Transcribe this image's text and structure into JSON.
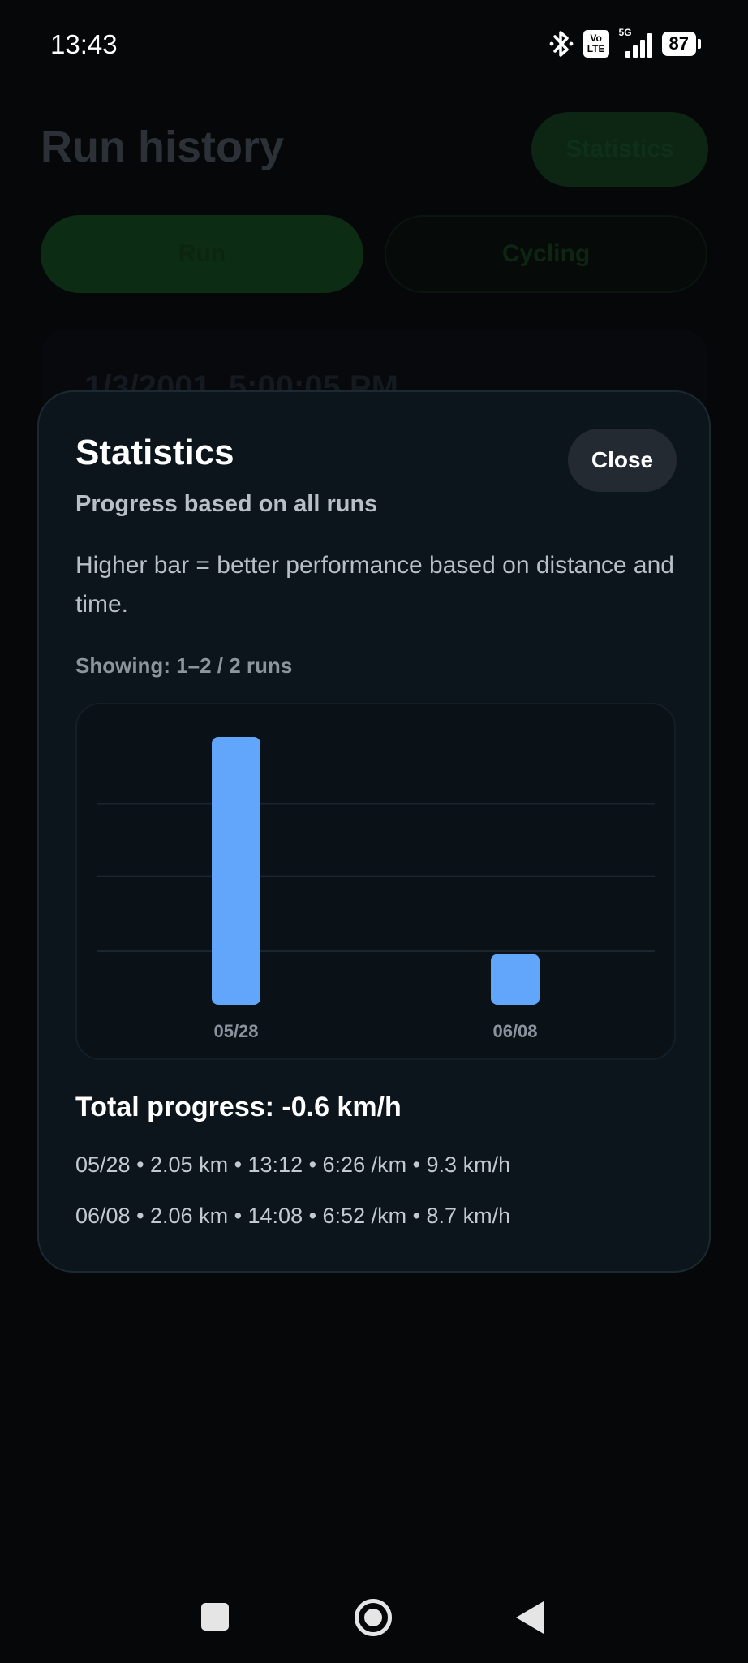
{
  "status_bar": {
    "time": "13:43",
    "volte_top": "Vo",
    "volte_bottom": "LTE",
    "network": "5G",
    "battery": "87"
  },
  "background": {
    "title": "Run history",
    "statistics_button": "Statistics",
    "tabs": [
      {
        "label": "Run",
        "selected": true
      },
      {
        "label": "Cycling",
        "selected": false
      }
    ],
    "card_date": "1/3/2001, 5:00:05 PM"
  },
  "modal": {
    "title": "Statistics",
    "close_label": "Close",
    "subtitle": "Progress based on all runs",
    "description": "Higher bar = better performance based on distance and time.",
    "showing": "Showing: 1–2 / 2 runs",
    "total_progress": "Total progress: -0.6 km/h",
    "runs": [
      {
        "summary": "05/28 • 2.05 km • 13:12 • 6:26 /km • 9.3 km/h"
      },
      {
        "summary": "06/08 • 2.06 km • 14:08 • 6:52 /km • 8.7 km/h"
      }
    ]
  },
  "chart_data": {
    "type": "bar",
    "categories": [
      "05/28",
      "06/08"
    ],
    "values": [
      9.3,
      8.7
    ],
    "title": "",
    "xlabel": "",
    "ylabel": "",
    "ylim": [
      8.56,
      9.3
    ],
    "grid": true,
    "bar_color": "#61a6fa",
    "grid_color": "#1a2530",
    "label_color": "#8a929c"
  },
  "colors": {
    "modal_bg": "#0d151c",
    "accent_green": "#0d2c14",
    "bar": "#61a6fa"
  },
  "icons": {
    "bluetooth": "bluetooth-icon",
    "signal": "signal-icon",
    "battery": "battery-icon",
    "nav_recents": "square-icon",
    "nav_home": "circle-icon",
    "nav_back": "triangle-back-icon"
  }
}
